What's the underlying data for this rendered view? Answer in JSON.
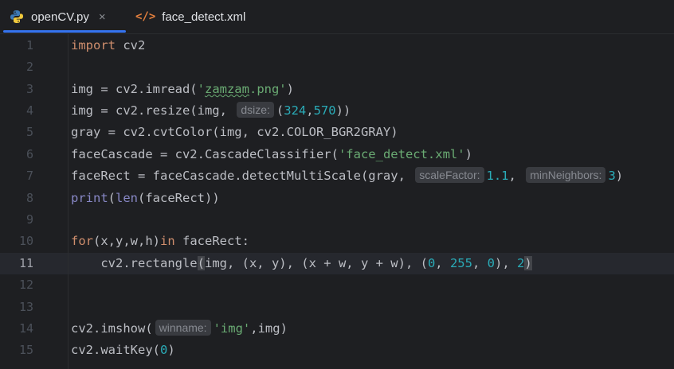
{
  "tabs": [
    {
      "label": "openCV.py",
      "icon": "python-icon",
      "active": true,
      "close": "×"
    },
    {
      "label": "face_detect.xml",
      "icon": "xml-icon",
      "icon_text": "</>"
    }
  ],
  "line_numbers": [
    "1",
    "2",
    "3",
    "4",
    "5",
    "6",
    "7",
    "8",
    "9",
    "10",
    "11",
    "12",
    "13",
    "14",
    "15"
  ],
  "active_line": "11",
  "code": {
    "l1_kw": "import",
    "l1_rest": " cv2",
    "l3_a": "img = cv2.imread(",
    "l3_q1": "'",
    "l3_str": "zamzam",
    "l3_q2": ".png'",
    "l3_b": ")",
    "l4_a": "img = cv2.resize(img, ",
    "l4_hint": "dsize:",
    "l4_b": "(",
    "l4_n1": "324",
    "l4_c": ",",
    "l4_n2": "570",
    "l4_d": "))",
    "l5": "gray = cv2.cvtColor(img, cv2.COLOR_BGR2GRAY)",
    "l6_a": "faceCascade = cv2.CascadeClassifier(",
    "l6_str": "'face_detect.xml'",
    "l6_b": ")",
    "l7_a": "faceRect = faceCascade.detectMultiScale(gray, ",
    "l7_hint1": "scaleFactor:",
    "l7_n1": "1.1",
    "l7_b": ", ",
    "l7_hint2": "minNeighbors:",
    "l7_n2": "3",
    "l7_c": ")",
    "l8_print": "print",
    "l8_a": "(",
    "l8_len": "len",
    "l8_b": "(faceRect))",
    "l10_for": "for",
    "l10_a": "(x,y,w,h)",
    "l10_in": "in",
    "l10_b": " faceRect:",
    "l11_a": "    cv2.rectangle",
    "l11_p1": "(",
    "l11_b": "img, (x, y), (x + w, y + w), (",
    "l11_n1": "0",
    "l11_c": ", ",
    "l11_n2": "255",
    "l11_d": ", ",
    "l11_n3": "0",
    "l11_e": "), ",
    "l11_n4": "2",
    "l11_p2": ")",
    "l14_a": "cv2.imshow(",
    "l14_hint": "winname:",
    "l14_str": "'img'",
    "l14_b": ",img)",
    "l15_a": "cv2.waitKey(",
    "l15_n": "0",
    "l15_b": ")"
  },
  "colors": {
    "background": "#1e1f22",
    "keyword": "#cf8e6d",
    "string": "#6aab73",
    "number": "#2aacb8",
    "builtin": "#8888c6",
    "tab_underline": "#3574f0"
  }
}
